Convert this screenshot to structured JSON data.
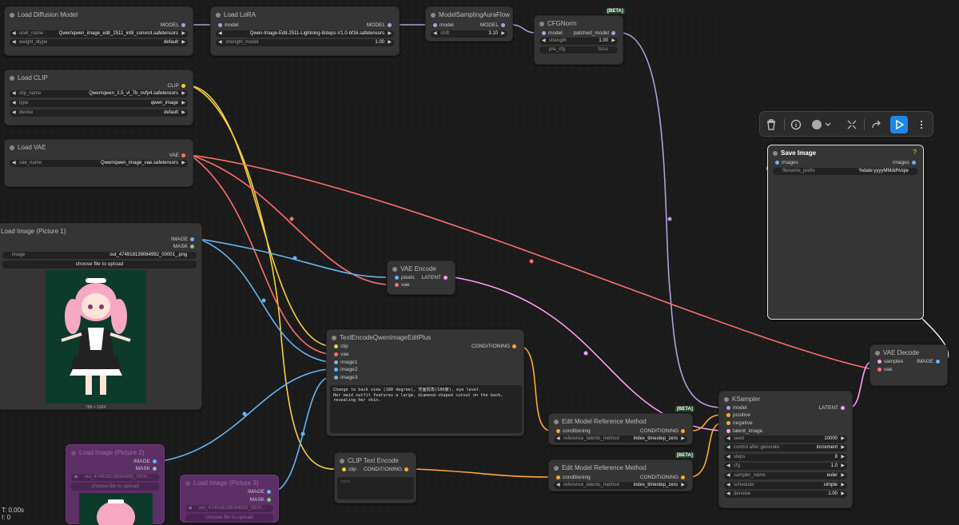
{
  "colors": {
    "model": "#b39ddb",
    "clip": "#f4d03f",
    "vae": "#ff6e6e",
    "image": "#64b5f6",
    "latent": "#ff9cf9",
    "conditioning": "#ffa931",
    "mask": "#81c784"
  },
  "nodes": {
    "load_diffusion": {
      "title": "Load Diffusion Model",
      "out_model": "MODEL",
      "unet_name_label": "unet_name",
      "unet_name_value": "Qwen\\qwen_image_edit_2511_int8_convrot.safetensors",
      "weight_dtype_label": "weight_dtype",
      "weight_dtype_value": "default"
    },
    "load_lora": {
      "title": "Load LoRA",
      "in_model": "model",
      "out_model": "MODEL",
      "lora_value": "Qwen-Image-Edit-2511-Lightning-8steps-V1.0-bf16.safetensors",
      "strength_label": "strength_model",
      "strength_value": "1.00"
    },
    "sampling_aura": {
      "title": "ModelSamplingAuraFlow",
      "in_model": "model",
      "out_model": "MODEL",
      "shift_label": "shift",
      "shift_value": "3.10"
    },
    "cfgnorm": {
      "title": "CFGNorm",
      "badge": "[BETA]",
      "in_model": "model",
      "out_model": "patched_model",
      "strength_label": "strength",
      "strength_value": "1.00",
      "pre_cfg_label": "pre_cfg",
      "pre_cfg_value": "false"
    },
    "load_clip": {
      "title": "Load CLIP",
      "out_clip": "CLIP",
      "clip_name_label": "clip_name",
      "clip_name_value": "Qwen\\qwen_2.5_vl_7b_nvfp4.safetensors",
      "type_label": "type",
      "type_value": "qwen_image",
      "device_label": "device",
      "device_value": "default"
    },
    "load_vae": {
      "title": "Load VAE",
      "out_vae": "VAE",
      "vae_name_label": "vae_name",
      "vae_name_value": "Qwen\\qwen_image_vae.safetensors"
    },
    "load_image1": {
      "title": "Load Image (Picture 1)",
      "out_image": "IMAGE",
      "out_mask": "MASK",
      "image_label": "image",
      "image_value": "out_474918139084992_00001_.png",
      "upload_label": "choose file to upload",
      "dims": "768 × 1024"
    },
    "vae_encode": {
      "title": "VAE Encode",
      "in_pixels": "pixels",
      "in_vae": "vae",
      "out_latent": "LATENT"
    },
    "text_encode_qwen": {
      "title": "TextEncodeQwenImageEditPlus",
      "in_clip": "clip",
      "in_vae": "vae",
      "in_image1": "image1",
      "in_image2": "image2",
      "in_image3": "image3",
      "out_cond": "CONDITIONING",
      "prompt_text": "Change to back view (180 degree), 背面视角(180度), eye level.\nHer maid outfit features a large, diamond-shaped cutout on the back, revealing her skin."
    },
    "edit_ref1": {
      "title": "Edit Model Reference Method",
      "badge": "[BETA]",
      "in_cond": "conditioning",
      "out_cond": "CONDITIONING",
      "method_label": "reference_latents_method",
      "method_value": "index_timestep_zero"
    },
    "edit_ref2": {
      "title": "Edit Model Reference Method",
      "badge": "[BETA]",
      "in_cond": "conditioning",
      "out_cond": "CONDITIONING",
      "method_label": "reference_latents_method",
      "method_value": "index_timestep_zero"
    },
    "clip_text_encode": {
      "title": "CLIP Text Encode",
      "in_clip": "clip",
      "out_cond": "CONDITIONING",
      "prompt_text": "text"
    },
    "ksampler": {
      "title": "KSampler",
      "in_model": "model",
      "in_positive": "positive",
      "in_negative": "negative",
      "in_latent": "latent_image",
      "out_latent": "LATENT",
      "widgets": [
        {
          "label": "seed",
          "value": "10000"
        },
        {
          "label": "control after generate",
          "value": "increment"
        },
        {
          "label": "steps",
          "value": "8"
        },
        {
          "label": "cfg",
          "value": "1.0"
        },
        {
          "label": "sampler_name",
          "value": "euler"
        },
        {
          "label": "scheduler",
          "value": "simple"
        },
        {
          "label": "denoise",
          "value": "1.00"
        }
      ]
    },
    "vae_decode": {
      "title": "VAE Decode",
      "in_samples": "samples",
      "in_vae": "vae",
      "out_image": "IMAGE"
    },
    "save_image": {
      "title": "Save Image",
      "help": "?",
      "in_images": "images",
      "out_images": "images",
      "prefix_label": "filename_prefix",
      "prefix_value": "%date:yyyyMMdd%/qie"
    },
    "load_image2": {
      "title": "Load Image (Picture 2)",
      "out_image": "IMAGE",
      "out_mask": "MASK",
      "image_value": "out_474918139084992_0000...",
      "upload_label": "choose file to upload"
    },
    "load_image3": {
      "title": "Load Image (Picture 3)",
      "out_image": "IMAGE",
      "out_mask": "MASK",
      "image_value": "out_474918139084992_0000...",
      "upload_label": "choose file to upload"
    }
  },
  "toolbar": {
    "delete_icon": "trash-icon",
    "info_icon": "info-icon",
    "color_icon": "color-circle-icon",
    "fit_icon": "fit-icon",
    "bypass_icon": "redo-icon",
    "run_icon": "play-icon",
    "more_icon": "more-icon"
  },
  "status": {
    "time": "T: 0.00s",
    "second_line": "I: 0"
  }
}
